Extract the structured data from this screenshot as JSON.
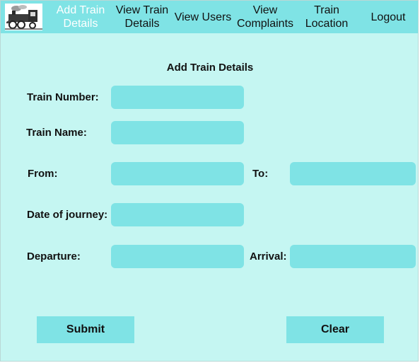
{
  "nav": {
    "items": [
      {
        "label_line1": "Add Train",
        "label_line2": "Details"
      },
      {
        "label_line1": "View Train",
        "label_line2": "Details"
      },
      {
        "label_line1": "View Users",
        "label_line2": ""
      },
      {
        "label_line1": "View",
        "label_line2": "Complaints"
      },
      {
        "label_line1": "Train",
        "label_line2": "Location"
      },
      {
        "label_line1": "Logout",
        "label_line2": ""
      }
    ],
    "active_index": 0
  },
  "form": {
    "title": "Add Train Details",
    "train_number_label": "Train Number:",
    "train_name_label": "Train Name:",
    "from_label": "From:",
    "to_label": "To:",
    "date_label": "Date of journey:",
    "departure_label": "Departure:",
    "arrival_label": "Arrival:",
    "train_number_value": "",
    "train_name_value": "",
    "from_value": "",
    "to_value": "",
    "date_value": "",
    "departure_value": "",
    "arrival_value": ""
  },
  "buttons": {
    "submit_label": "Submit",
    "clear_label": "Clear"
  },
  "colors": {
    "background": "#c5f6f2",
    "nav": "#7fe3e5",
    "field": "#7fe3e5",
    "active_nav_text": "#ffffff"
  }
}
